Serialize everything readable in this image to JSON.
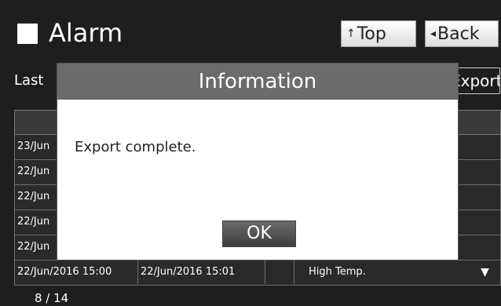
{
  "header": {
    "title": "Alarm",
    "top_button": {
      "arrow": "↑",
      "label": "Top"
    },
    "back_button": {
      "arrow": "◂",
      "label": "Back"
    }
  },
  "toolbar": {
    "last_label": "Last",
    "export_label": "Export"
  },
  "table": {
    "rows": [
      {
        "start": "23/Jun",
        "end": "",
        "flag": "",
        "name": "",
        "mark": ""
      },
      {
        "start": "22/Jun",
        "end": "",
        "flag": "",
        "name": "",
        "mark": ""
      },
      {
        "start": "22/Jun",
        "end": "",
        "flag": "",
        "name": "",
        "mark": ""
      },
      {
        "start": "22/Jun",
        "end": "",
        "flag": "",
        "name": "",
        "mark": ""
      },
      {
        "start": "22/Jun",
        "end": "",
        "flag": "",
        "name": "",
        "mark": ""
      },
      {
        "start": "22/Jun/2016 15:00",
        "end": "22/Jun/2016 15:01",
        "flag": "",
        "name": "High Temp.",
        "mark": "▼"
      }
    ]
  },
  "pagination": {
    "text": "8 / 14"
  },
  "dialog": {
    "title": "Information",
    "message": "Export complete.",
    "ok_label": "OK"
  }
}
